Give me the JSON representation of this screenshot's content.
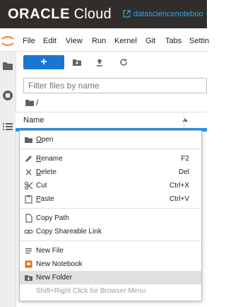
{
  "header": {
    "brand": "ORACLE",
    "product": "Cloud",
    "link_text": "datasciencenoteboo"
  },
  "menubar": {
    "items": [
      "File",
      "Edit",
      "View",
      "Run",
      "Kernel",
      "Git",
      "Tabs",
      "Settin"
    ]
  },
  "file_browser": {
    "new_launcher_label": "+",
    "filter_placeholder": "Filter files by name",
    "breadcrumb_root": "/",
    "column_name": "Name"
  },
  "context_menu": {
    "open": "Open",
    "rename": "Rename",
    "rename_key": "F2",
    "delete": "Delete",
    "delete_key": "Del",
    "cut": "Cut",
    "cut_key": "Ctrl+X",
    "paste": "Paste",
    "paste_key": "Ctrl+V",
    "copy_path": "Copy Path",
    "copy_shareable_link": "Copy Shareable Link",
    "new_file": "New File",
    "new_notebook": "New Notebook",
    "new_folder": "New Folder",
    "hint": "Shift+Right Click for Browser Menu"
  },
  "colors": {
    "oracle_header": "#312d2a",
    "accent": "#1976d2",
    "link": "#33a6e7",
    "notebook_icon": "#ef6c00"
  }
}
